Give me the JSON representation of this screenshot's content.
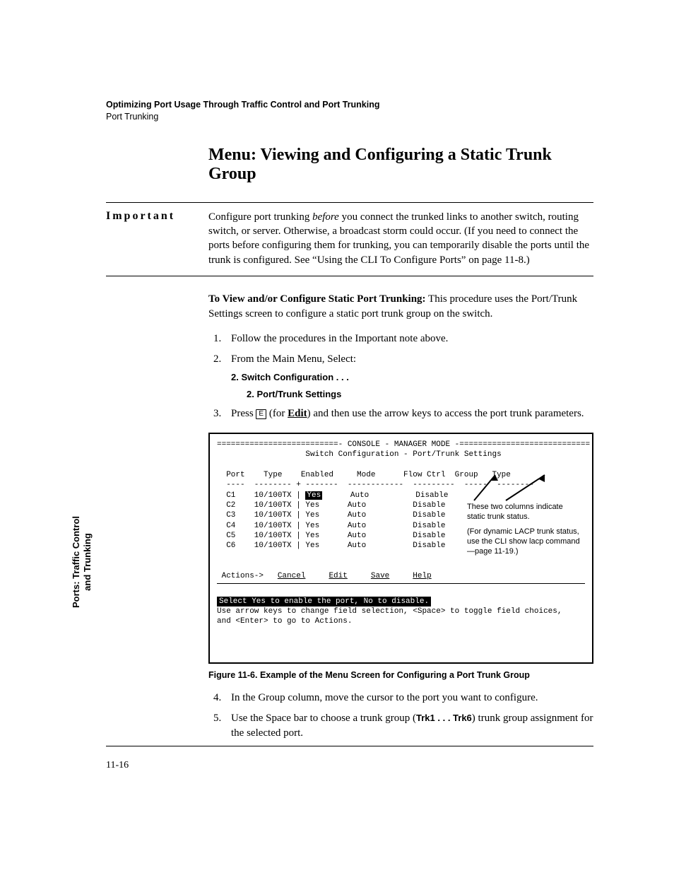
{
  "header": {
    "line1": "Optimizing Port Usage Through Traffic Control and Port Trunking",
    "line2": "Port Trunking"
  },
  "title": "Menu: Viewing and Configuring a Static Trunk Group",
  "important": {
    "label": "Important",
    "text_before_italic": "Configure port trunking ",
    "italic": "before",
    "text_after_italic": " you connect the trunked links to another switch, routing switch, or server. Otherwise, a broadcast storm could occur. (If you need to connect the ports before configuring them for trunking, you can temporarily disable the ports until the trunk is configured. See “Using the CLI To Configure Ports” on page 11-8.)"
  },
  "intro": {
    "bold": "To View and/or Configure Static Port Trunking:",
    "rest": "  This procedure uses the Port/Trunk Settings screen to configure a static port trunk group on the switch."
  },
  "steps": {
    "s1": "Follow the procedures in the Important note above.",
    "s2": "From the Main Menu, Select:",
    "s2a": "2. Switch Configuration . . .",
    "s2b": "2. Port/Trunk Settings",
    "s3_pre": "Press ",
    "s3_key": "E",
    "s3_mid": " (for ",
    "s3_bold": "Edit",
    "s3_post": ") and then use the arrow keys to access the port trunk parameters.",
    "s4": "In the Group column, move the cursor to the port you want to configure.",
    "s5_pre": "Use the Space bar to choose a trunk group (",
    "s5_bold": "Trk1 . . . Trk6",
    "s5_post": ") trunk group assignment for the selected port."
  },
  "console": {
    "line_top": "==========================- CONSOLE - MANAGER MODE -============================",
    "subtitle": "Switch Configuration - Port/Trunk Settings",
    "hdr": "  Port    Type    Enabled     Mode      Flow Ctrl  Group   Type",
    "sep": "  ----  -------- + -------  ------------  ---------  -----  --------",
    "rows": [
      "  C1    10/100TX | ",
      "  C2    10/100TX | Yes      Auto          Disable",
      "  C3    10/100TX | Yes      Auto          Disable",
      "  C4    10/100TX | Yes      Auto          Disable",
      "  C5    10/100TX | Yes      Auto          Disable",
      "  C6    10/100TX | Yes      Auto          Disable"
    ],
    "row0_yes": "Yes",
    "row0_rest": "      Auto          Disable",
    "actions_pre": " Actions->   ",
    "actions": [
      "Cancel",
      "Edit",
      "Save",
      "Help"
    ],
    "help1": "Select Yes to enable the port, No to disable.",
    "help2": "Use arrow keys to change field selection, <Space> to toggle field choices,",
    "help3": "and <Enter> to go to Actions."
  },
  "callout": {
    "l1": "These two columns indicate static trunk status.",
    "l2": "(For dynamic LACP trunk status, use the CLI show lacp command—page 11-19.)"
  },
  "figcaption": "Figure 11-6.  Example of the Menu Screen for Configuring a Port Trunk Group",
  "sidetab": {
    "l1": "Ports: Traffic Control",
    "l2": "and Trunking"
  },
  "pagenum": "11-16"
}
